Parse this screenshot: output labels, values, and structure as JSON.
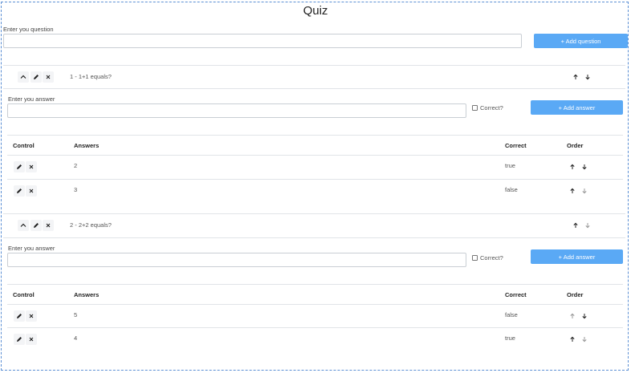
{
  "title": "Quiz",
  "question_form": {
    "label": "Enter you question",
    "value": "",
    "add_button": "+ Add question"
  },
  "table_headers": {
    "control": "Control",
    "answers": "Answers",
    "correct": "Correct",
    "order": "Order"
  },
  "questions": [
    {
      "text": "1 - 1+1 equals?",
      "answer_label": "Enter you answer",
      "answer_value": "",
      "correct_label": "Correct?",
      "add_answer": "+ Add answer",
      "answers": [
        {
          "text": "2",
          "correct": "true"
        },
        {
          "text": "3",
          "correct": "false"
        }
      ]
    },
    {
      "text": "2 - 2+2 equals?",
      "answer_label": "Enter you answer",
      "answer_value": "",
      "correct_label": "Correct?",
      "add_answer": "+ Add answer",
      "answers": [
        {
          "text": "5",
          "correct": "false"
        },
        {
          "text": "4",
          "correct": "true"
        }
      ]
    }
  ],
  "colors": {
    "accent": "#5aa9f5",
    "frame_border": "#5b8fd4"
  }
}
